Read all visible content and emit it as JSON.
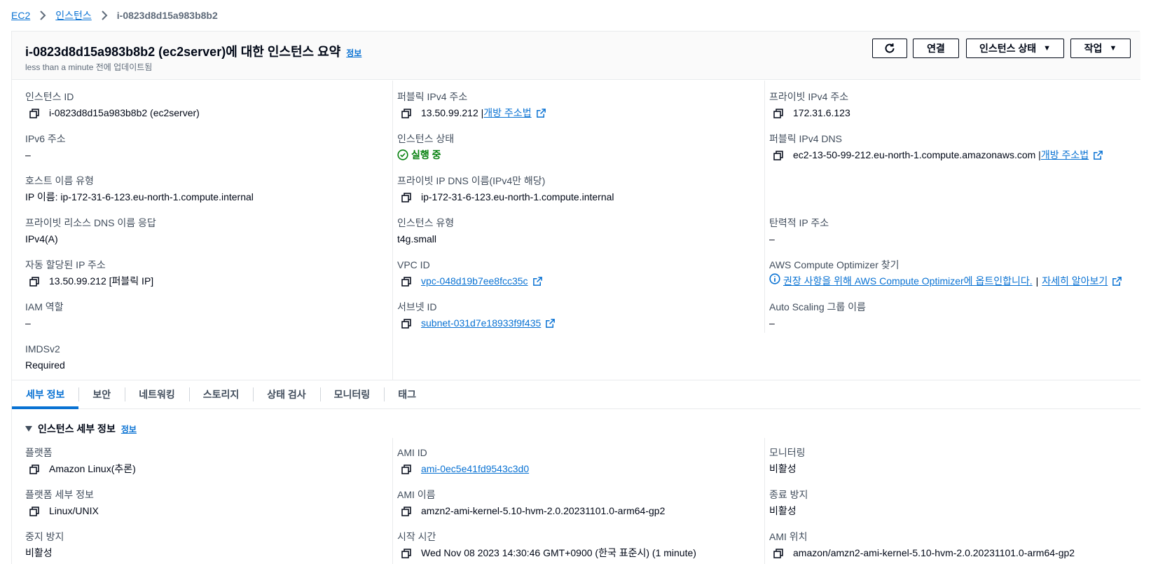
{
  "breadcrumb": {
    "root": "EC2",
    "section": "인스턴스",
    "current": "i-0823d8d15a983b8b2"
  },
  "header": {
    "title": "i-0823d8d15a983b8b2 (ec2server)에 대한 인스턴스 요약",
    "info": "정보",
    "subtitle": "less than a minute 전에 업데이트됨",
    "buttons": {
      "refresh_icon": "refresh-icon",
      "connect": "연결",
      "instance_state": "인스턴스 상태",
      "actions": "작업"
    }
  },
  "summary": {
    "instance_id": {
      "label": "인스턴스 ID",
      "value": "i-0823d8d15a983b8b2 (ec2server)"
    },
    "ipv6": {
      "label": "IPv6 주소",
      "value": "–"
    },
    "hostname_type": {
      "label": "호스트 이름 유형",
      "value": "IP 이름: ip-172-31-6-123.eu-north-1.compute.internal"
    },
    "private_dns_answer": {
      "label": "프라이빗 리소스 DNS 이름 응답",
      "value": "IPv4(A)"
    },
    "auto_ip": {
      "label": "자동 할당된 IP 주소",
      "value": "13.50.99.212 [퍼블릭 IP]"
    },
    "iam_role": {
      "label": "IAM 역할",
      "value": "–"
    },
    "imdsv2": {
      "label": "IMDSv2",
      "value": "Required"
    },
    "public_ipv4": {
      "label": "퍼블릭 IPv4 주소",
      "value": "13.50.99.212 |",
      "link": "개방 주소법"
    },
    "instance_state": {
      "label": "인스턴스 상태",
      "value": "실행 중"
    },
    "private_ip_dns": {
      "label": "프라이빗 IP DNS 이름(IPv4만 해당)",
      "value": "ip-172-31-6-123.eu-north-1.compute.internal"
    },
    "instance_type": {
      "label": "인스턴스 유형",
      "value": "t4g.small"
    },
    "vpc_id": {
      "label": "VPC ID",
      "value": "vpc-048d19b7ee8fcc35c"
    },
    "subnet_id": {
      "label": "서브넷 ID",
      "value": "subnet-031d7e18933f9f435"
    },
    "private_ipv4": {
      "label": "프라이빗 IPv4 주소",
      "value": "172.31.6.123"
    },
    "public_dns": {
      "label": "퍼블릭 IPv4 DNS",
      "value": "ec2-13-50-99-212.eu-north-1.compute.amazonaws.com |",
      "link": "개방 주소법"
    },
    "elastic_ip": {
      "label": "탄력적 IP 주소",
      "value": "–"
    },
    "optimizer": {
      "label": "AWS Compute Optimizer 찾기",
      "value": "권장 사항을 위해 AWS Compute Optimizer에 옵트인합니다.",
      "sep": "|",
      "link": "자세히 알아보기"
    },
    "asg_name": {
      "label": "Auto Scaling 그룹 이름",
      "value": "–"
    }
  },
  "tabs": [
    {
      "label": "세부 정보",
      "active": true
    },
    {
      "label": "보안"
    },
    {
      "label": "네트워킹"
    },
    {
      "label": "스토리지"
    },
    {
      "label": "상태 검사"
    },
    {
      "label": "모니터링"
    },
    {
      "label": "태그"
    }
  ],
  "details": {
    "section_title": "인스턴스 세부 정보",
    "info": "정보",
    "platform": {
      "label": "플랫폼",
      "value": "Amazon Linux(추론)"
    },
    "platform_details": {
      "label": "플랫폼 세부 정보",
      "value": "Linux/UNIX"
    },
    "stop_protection": {
      "label": "중지 방지",
      "value": "비활성"
    },
    "ami_id": {
      "label": "AMI ID",
      "value": "ami-0ec5e41fd9543c3d0"
    },
    "ami_name": {
      "label": "AMI 이름",
      "value": "amzn2-ami-kernel-5.10-hvm-2.0.20231101.0-arm64-gp2"
    },
    "launch_time": {
      "label": "시작 시간",
      "value": "Wed Nov 08 2023 14:30:46 GMT+0900 (한국 표준시) (1 minute)"
    },
    "monitoring": {
      "label": "모니터링",
      "value": "비활성"
    },
    "termination_protection": {
      "label": "종료 방지",
      "value": "비활성"
    },
    "ami_location": {
      "label": "AMI 위치",
      "value": "amazon/amzn2-ami-kernel-5.10-hvm-2.0.20231101.0-arm64-gp2"
    }
  },
  "colors": {
    "link": "#0972d3",
    "success": "#037f0c",
    "text": "#000716",
    "muted": "#5f6b7a"
  }
}
